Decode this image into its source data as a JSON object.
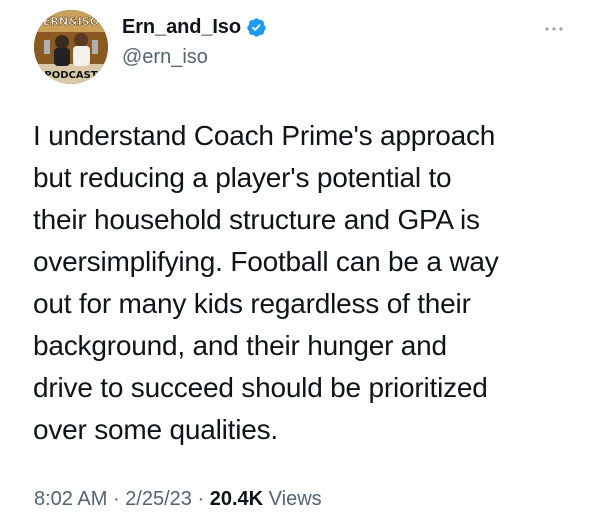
{
  "author": {
    "display_name": "Ern_and_Iso",
    "handle": "@ern_iso",
    "verified": true,
    "avatar": {
      "top_text": "ERN&ISO",
      "bottom_text": "PODCAST"
    }
  },
  "tweet": {
    "text_lines": [
      "I understand Coach Prime's approach",
      "but reducing a player's potential to",
      "their household structure and GPA is",
      "oversimplifying. Football can be a way",
      "out for many kids regardless of their",
      "background, and their hunger and",
      "drive to succeed should be prioritized",
      "over some qualities."
    ],
    "time": "8:02 AM",
    "date": "2/25/23",
    "separator": "·",
    "views_count": "20.4K",
    "views_label": "Views"
  },
  "icons": {
    "verified": "verified-badge-icon",
    "more": "more-options-icon"
  },
  "colors": {
    "text_primary": "#0f1419",
    "text_secondary": "#536471",
    "verified_blue": "#1d9bf0"
  }
}
